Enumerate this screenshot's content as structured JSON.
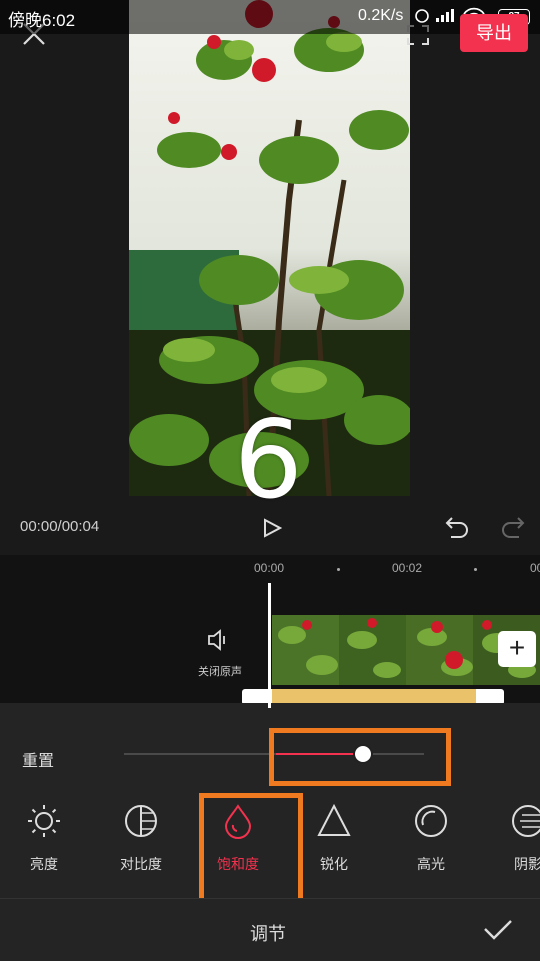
{
  "status_bar": {
    "time": "傍晚6:02",
    "network_speed": "0.2K/s",
    "battery": "87"
  },
  "header": {
    "export_label": "导出"
  },
  "preview": {
    "timecode": "00:00/00:04",
    "overlay_number": "6"
  },
  "timeline": {
    "ruler": [
      "00:00",
      "00:02",
      "00"
    ],
    "mute_label": "关闭原声",
    "add_label": "+"
  },
  "adjust": {
    "reset_label": "重置",
    "saturation_level": 0.8,
    "tools": [
      {
        "label": "亮度",
        "icon": "sun-icon"
      },
      {
        "label": "对比度",
        "icon": "contrast-icon"
      },
      {
        "label": "饱和度",
        "icon": "droplet-icon",
        "active": true
      },
      {
        "label": "锐化",
        "icon": "triangle-icon"
      },
      {
        "label": "高光",
        "icon": "highlight-icon"
      },
      {
        "label": "阴影",
        "icon": "shadow-icon"
      }
    ],
    "title": "调节"
  },
  "colors": {
    "accent": "#f2324e",
    "highlight_box": "#f07a1f",
    "audio_track": "#e9c26a"
  }
}
